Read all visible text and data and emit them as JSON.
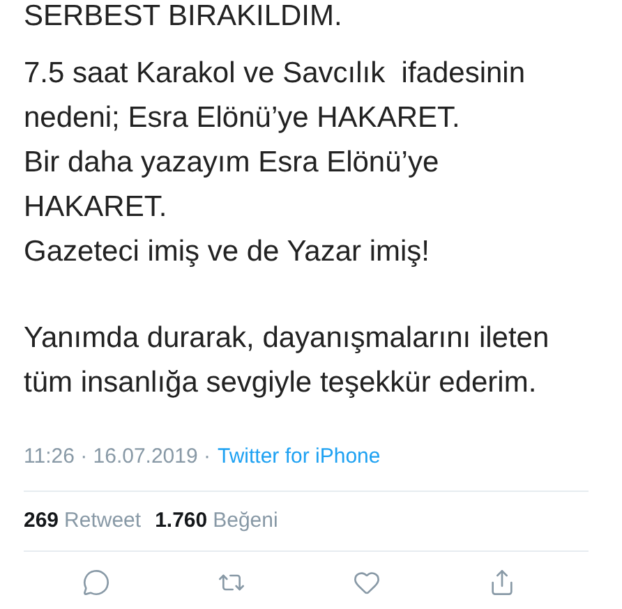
{
  "tweet": {
    "paragraphs": [
      {
        "lines": [
          "SERBEST BIRAKILDIM."
        ]
      },
      {
        "lines": [
          "7.5 saat Karakol ve Savcılık  ifadesinin",
          "nedeni; Esra Elönü’ye HAKARET.",
          "Bir daha yazayım Esra Elönü’ye",
          "HAKARET.",
          "Gazeteci imiş ve de Yazar imiş!"
        ]
      },
      {
        "lines": [
          "Yanımda durarak, dayanışmalarını ileten",
          "tüm insanlığa sevgiyle teşekkür ederim."
        ]
      }
    ],
    "timestamp": "11:26 · 16.07.2019 ·",
    "source": "Twitter for iPhone",
    "stats": [
      {
        "count": "269",
        "label": "Retweet"
      },
      {
        "count": "1.760",
        "label": "Beğeni"
      }
    ],
    "actions": [
      {
        "kind": "reply"
      },
      {
        "kind": "retweet"
      },
      {
        "kind": "like"
      },
      {
        "kind": "share"
      }
    ]
  }
}
